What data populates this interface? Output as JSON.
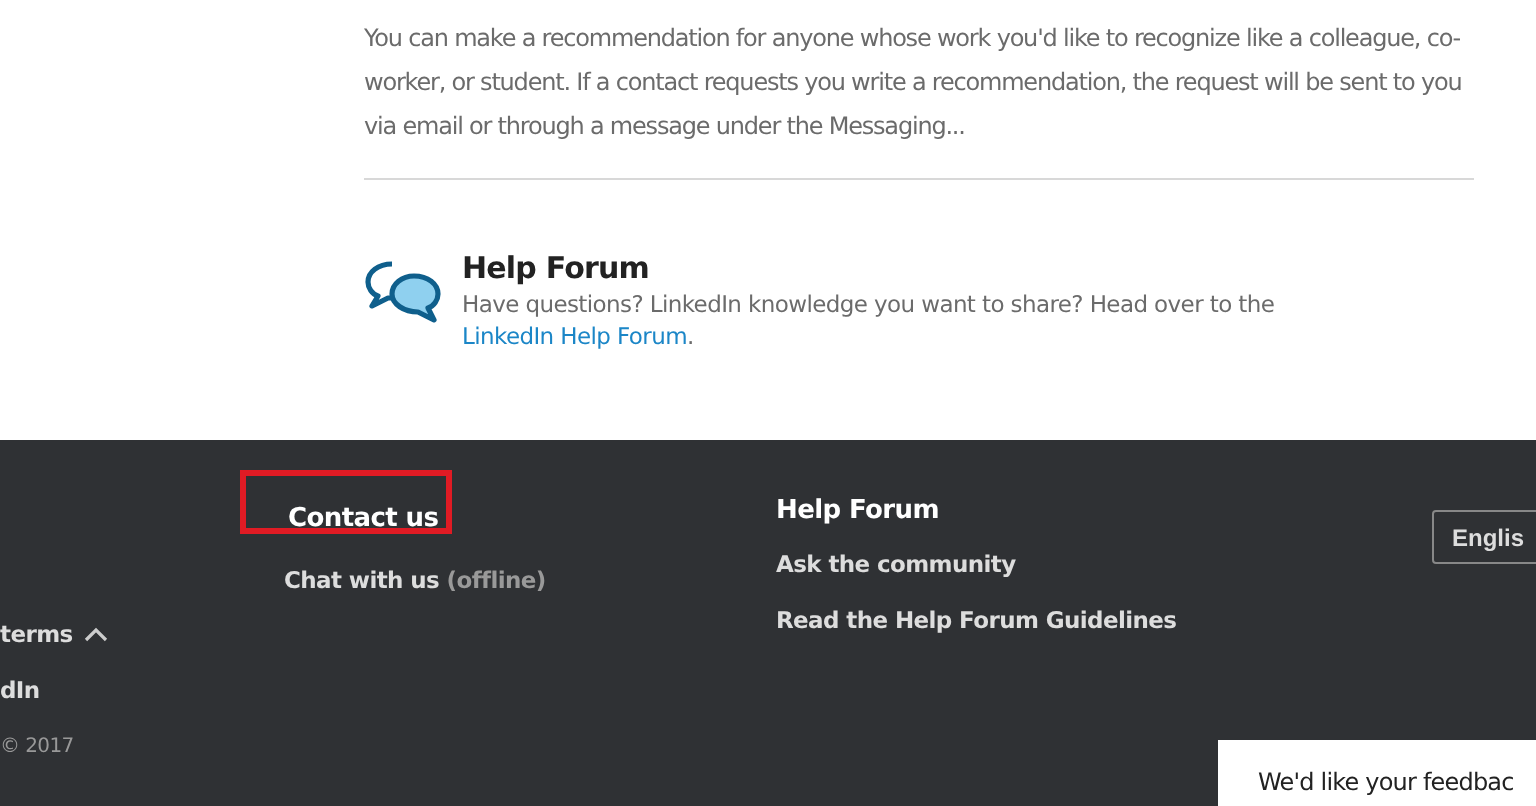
{
  "article": {
    "summary": "You can make a recommendation for anyone whose work you'd like to recognize like a colleague, co-worker, or student. If a contact requests you write a recommendation, the request will be sent to you via email or through a message under the Messaging..."
  },
  "help_forum": {
    "title": "Help Forum",
    "text": "Have questions? LinkedIn knowledge you want to share? Head over to the",
    "link": "LinkedIn Help Forum",
    "end": "."
  },
  "footer": {
    "left": [
      {
        "kind": "toggle",
        "label": "terms",
        "expanded": true
      },
      {
        "kind": "link",
        "label": "dIn"
      },
      {
        "kind": "note",
        "label": "© 2017"
      }
    ],
    "contact": {
      "title": "Contact us",
      "highlighted": true,
      "chat": "Chat with us",
      "status": "(offline)"
    },
    "forum": {
      "title": "Help Forum",
      "links": [
        "Ask the community",
        "Read the Help Forum Guidelines"
      ]
    },
    "language": "Englis"
  },
  "feedback": {
    "text": "We'd like your feedbac"
  }
}
